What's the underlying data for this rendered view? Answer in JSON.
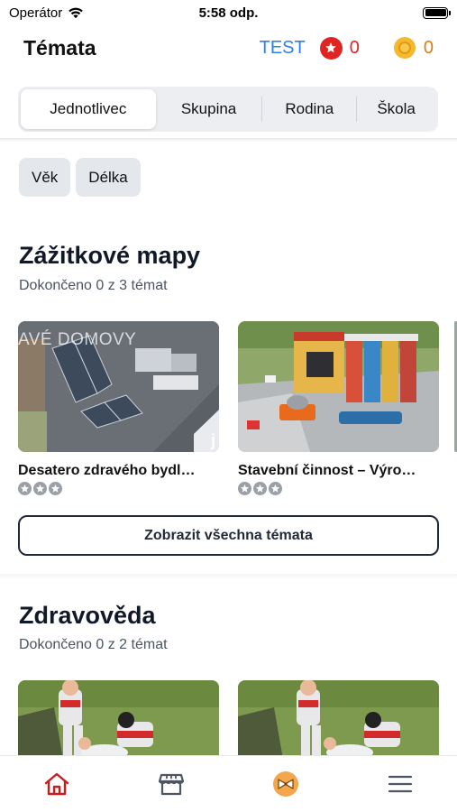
{
  "status_bar": {
    "carrier": "Operátor",
    "time": "5:58 odp."
  },
  "header": {
    "title": "Témata",
    "test_label": "TEST",
    "stars_count": "0",
    "coins_count": "0"
  },
  "segments": [
    {
      "label": "Jednotlivec",
      "active": true
    },
    {
      "label": "Skupina",
      "active": false
    },
    {
      "label": "Rodina",
      "active": false
    },
    {
      "label": "Škola",
      "active": false
    }
  ],
  "filters": [
    "Věk",
    "Délka"
  ],
  "sections": [
    {
      "title": "Zážitkové mapy",
      "subtitle": "Dokončeno 0 z 3 témat",
      "cards": [
        {
          "title": "Desatero zdravého bydl…",
          "image": "house-rooftop-solar-panels",
          "overlay_text": "AVÉ DOMOVY",
          "corner_text": "j",
          "rating": 0,
          "rating_max": 3
        },
        {
          "title": "Stavební činnost – Výro…",
          "image": "concrete-plant-model",
          "rating": 0,
          "rating_max": 3
        }
      ],
      "show_all_label": "Zobrazit všechna témata"
    },
    {
      "title": "Zdravověda",
      "subtitle": "Dokončeno 0 z 2 témat",
      "cards": [
        {
          "image": "first-aid-figurines"
        },
        {
          "image": "first-aid-figurines"
        }
      ]
    }
  ],
  "tabbar": [
    {
      "icon": "home-icon",
      "active": true
    },
    {
      "icon": "shop-icon",
      "active": false
    },
    {
      "icon": "ticket-icon",
      "active": false
    },
    {
      "icon": "menu-icon",
      "active": false
    }
  ],
  "colors": {
    "accent_blue": "#2f80ed",
    "star_red": "#e02424",
    "coin_orange": "#e07b16",
    "tab_active": "#c81e1e"
  }
}
